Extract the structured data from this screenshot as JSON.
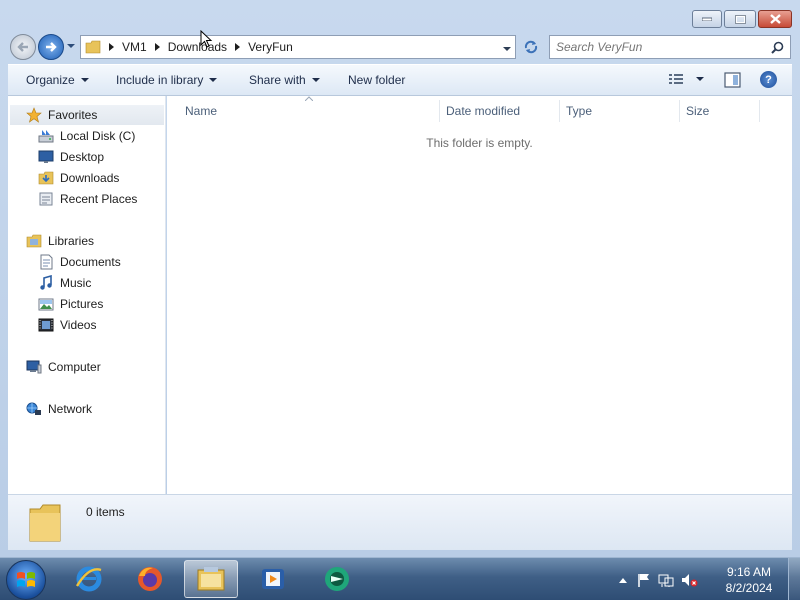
{
  "window": {
    "minimize_icon": "minimize-icon",
    "maximize_icon": "maximize-icon",
    "close_icon": "close-icon"
  },
  "navbar": {
    "breadcrumb": [
      "VM1",
      "Downloads",
      "VeryFun"
    ],
    "search_placeholder": "Search VeryFun"
  },
  "toolbar": {
    "organize": "Organize",
    "include_in_library": "Include in library",
    "share_with": "Share with",
    "new_folder": "New folder"
  },
  "sidebar": {
    "favorites": {
      "label": "Favorites",
      "items": [
        {
          "label": "Local Disk (C)",
          "icon": "drive-icon"
        },
        {
          "label": "Desktop",
          "icon": "desktop-icon"
        },
        {
          "label": "Downloads",
          "icon": "downloads-folder-icon"
        },
        {
          "label": "Recent Places",
          "icon": "recent-places-icon"
        }
      ]
    },
    "libraries": {
      "label": "Libraries",
      "items": [
        {
          "label": "Documents",
          "icon": "documents-icon"
        },
        {
          "label": "Music",
          "icon": "music-icon"
        },
        {
          "label": "Pictures",
          "icon": "pictures-icon"
        },
        {
          "label": "Videos",
          "icon": "videos-icon"
        }
      ]
    },
    "computer": {
      "label": "Computer"
    },
    "network": {
      "label": "Network"
    }
  },
  "content": {
    "columns": [
      "Name",
      "Date modified",
      "Type",
      "Size"
    ],
    "empty_message": "This folder is empty."
  },
  "details": {
    "item_count": "0 items"
  },
  "taskbar": {
    "apps": [
      "internet-explorer-icon",
      "firefox-icon",
      "file-explorer-icon",
      "media-player-icon",
      "green-app-icon"
    ],
    "clock_time": "9:16 AM",
    "clock_date": "8/2/2024"
  },
  "colors": {
    "accent": "#1d5fb6",
    "taskbar": "#3f5f86",
    "folder": "#e8c35a"
  }
}
